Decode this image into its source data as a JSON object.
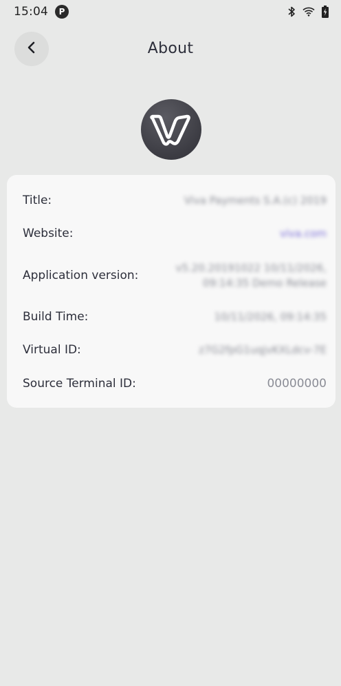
{
  "status_bar": {
    "time": "15:04",
    "app_icon_letter": "P"
  },
  "header": {
    "title": "About",
    "back_icon": "chevron-left-icon"
  },
  "logo": {
    "icon": "viva-logo-icon"
  },
  "info": {
    "rows": [
      {
        "label": "Title:",
        "value": "Viva Payments S.A.(c) 2019"
      },
      {
        "label": "Website:",
        "value": "viva.com"
      },
      {
        "label": "Application version:",
        "value": "v5.20.20191022 10/11/2026, 09:14:35 Demo Release"
      },
      {
        "label": "Build Time:",
        "value": "10/11/2026, 09:14:35"
      },
      {
        "label": "Virtual ID:",
        "value": "z7G2fpG1uqjvKXLdcv-7E"
      },
      {
        "label": "Source Terminal ID:",
        "value": "00000000"
      }
    ]
  },
  "colors": {
    "background": "#e8e9e8",
    "card": "#f8f8f8",
    "link": "#7b6fd8"
  }
}
